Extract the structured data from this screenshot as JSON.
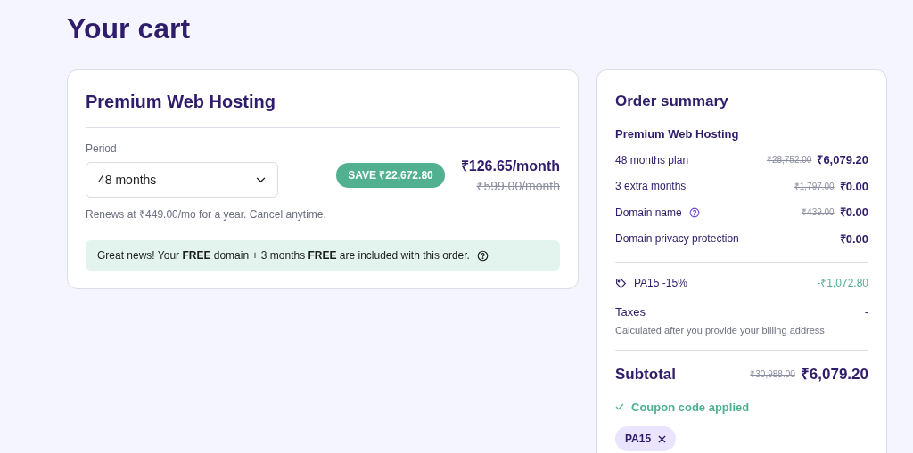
{
  "page_title": "Your cart",
  "product": {
    "title": "Premium Web Hosting",
    "period_label": "Period",
    "period_value": "48 months",
    "save_badge": "SAVE ₹22,672.80",
    "price": "₹126.65/month",
    "old_price": "₹599.00/month",
    "renewal_note": "Renews at ₹449.00/mo for a year. Cancel anytime.",
    "notice": "Great news! Your **FREE** domain + 3 months **FREE** are included with this order."
  },
  "summary": {
    "title": "Order summary",
    "product_name": "Premium Web Hosting",
    "lines": [
      {
        "label": "48 months plan",
        "old_price": "₹28,752.00",
        "price": "₹6,079.20",
        "help": false
      },
      {
        "label": "3 extra months",
        "old_price": "₹1,797.00",
        "price": "₹0.00",
        "help": false
      },
      {
        "label": "Domain name",
        "old_price": "₹439.00",
        "price": "₹0.00",
        "help": true
      },
      {
        "label": "Domain privacy protection",
        "price": "₹0.00",
        "help": false
      }
    ],
    "discount": {
      "label": "PA15 -15%",
      "amount": "-₹1,072.80"
    },
    "taxes": {
      "label": "Taxes",
      "value": "-",
      "note": "Calculated after you provide your billing address"
    },
    "subtotal": {
      "label": "Subtotal",
      "old_price": "₹30,988.00",
      "price": "₹6,079.20"
    },
    "coupon_status": "Coupon code applied",
    "coupon_chip": "PA15"
  }
}
